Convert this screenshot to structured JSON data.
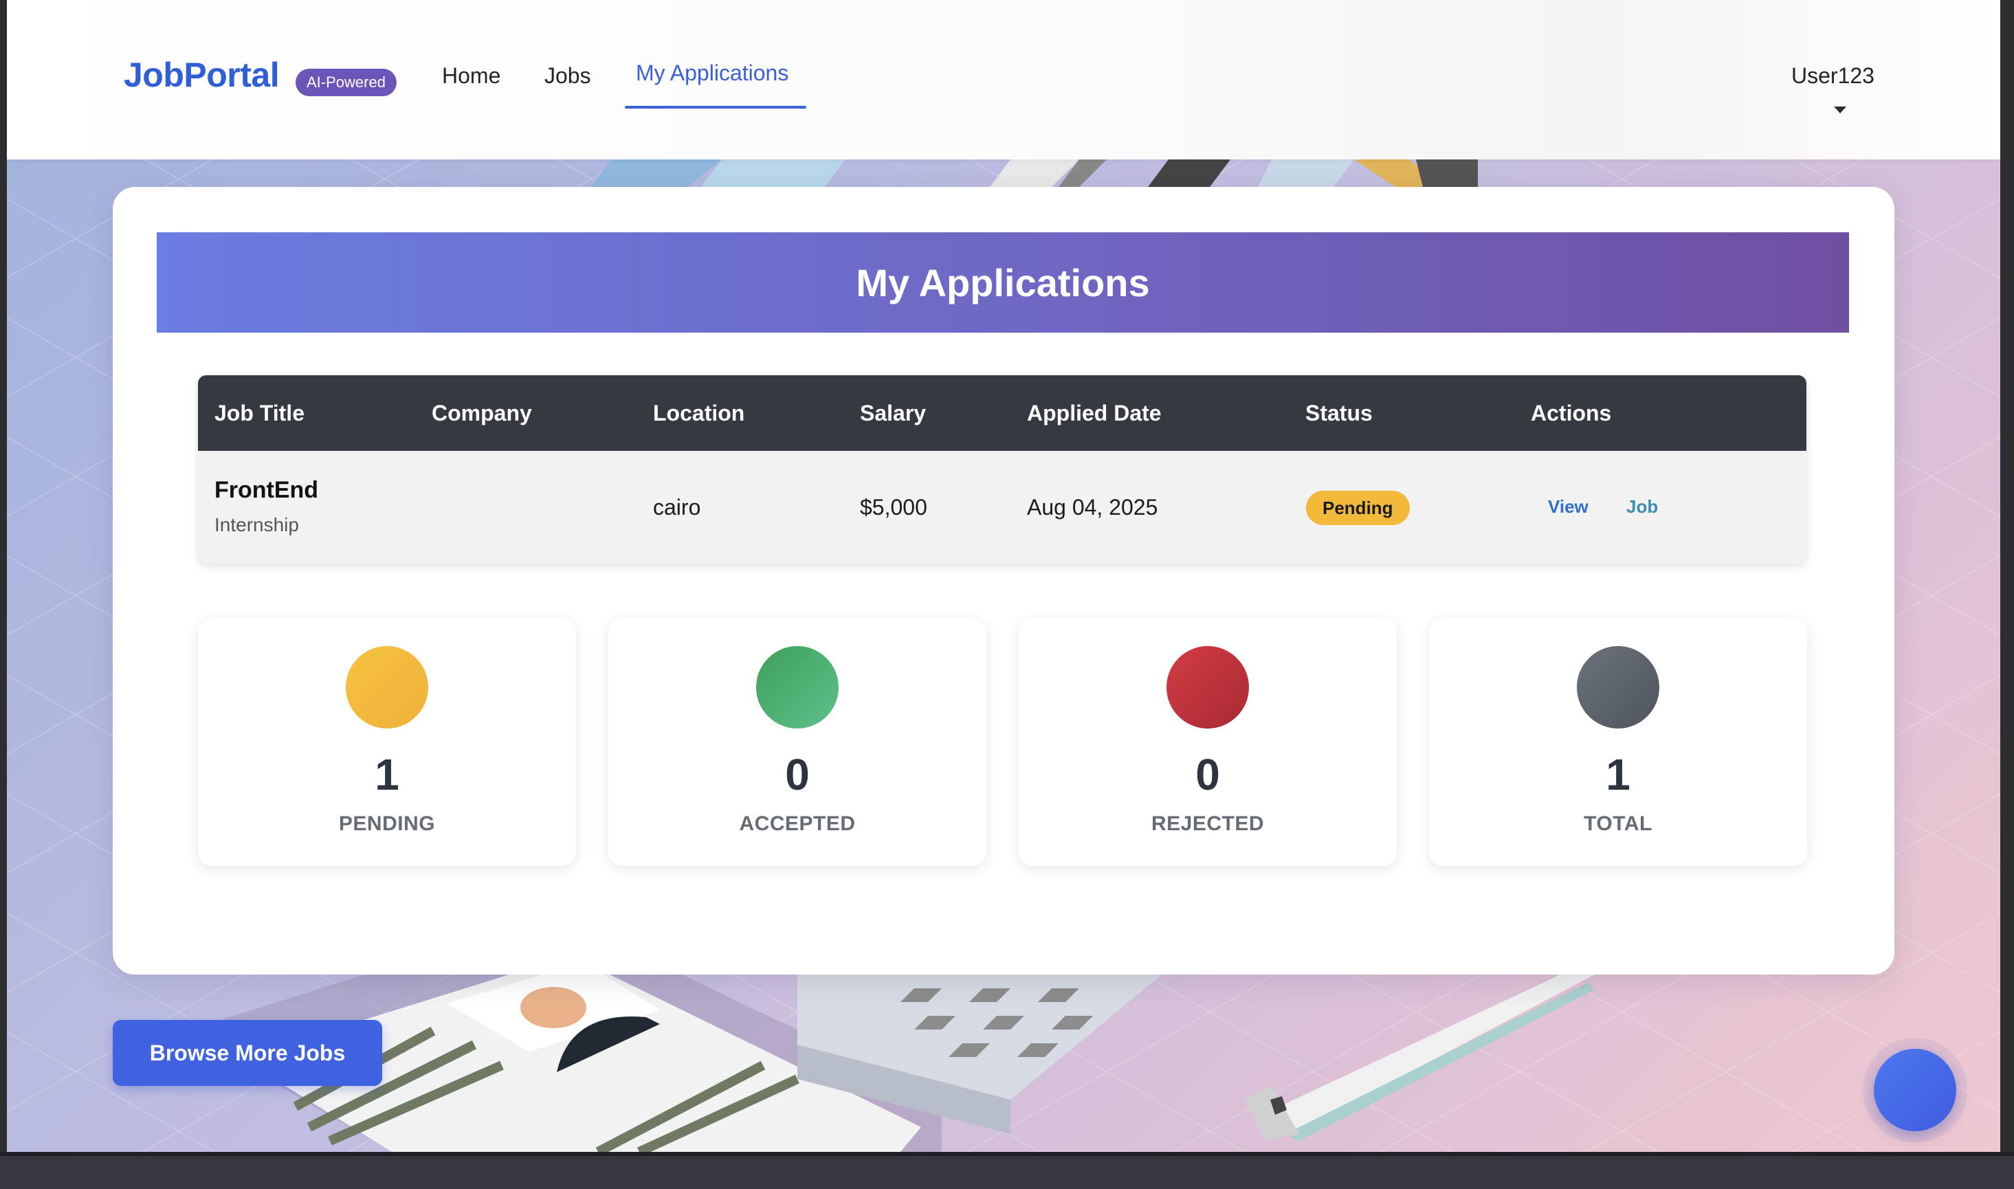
{
  "navbar": {
    "brand": "JobPortal",
    "badge": "AI-Powered",
    "links": [
      "Home",
      "Jobs",
      "My Applications"
    ],
    "user": "User123"
  },
  "page": {
    "title": "My Applications"
  },
  "table": {
    "headers": [
      "Job Title",
      "Company",
      "Location",
      "Salary",
      "Applied Date",
      "Status",
      "Actions"
    ],
    "rows": [
      {
        "title": "FrontEnd",
        "type": "Internship",
        "company": "",
        "location": "cairo",
        "salary": "$5,000",
        "applied_date": "Aug 04, 2025",
        "status": "Pending",
        "actions": [
          "View",
          "Job"
        ]
      }
    ]
  },
  "stats": [
    {
      "value": "1",
      "label": "PENDING",
      "color": "#f3b73a"
    },
    {
      "value": "0",
      "label": "ACCEPTED",
      "color": "#4cae6a"
    },
    {
      "value": "0",
      "label": "REJECTED",
      "color": "#c0353d"
    },
    {
      "value": "1",
      "label": "TOTAL",
      "color": "#5e656d"
    }
  ],
  "buttons": {
    "browse": "Browse More Jobs"
  },
  "colors": {
    "brand": "#2f5fd6",
    "accent": "#3f63e0",
    "header_gradient_start": "#6a7de0",
    "header_gradient_end": "#6f4fa2",
    "table_header": "#343a40",
    "status_pending": "#f2b93b",
    "view_link": "#2f6fd0",
    "job_link": "#3a8fb0"
  },
  "icons": {
    "fab": "chat-bubble-icon",
    "user_menu": "chevron-down-icon"
  }
}
